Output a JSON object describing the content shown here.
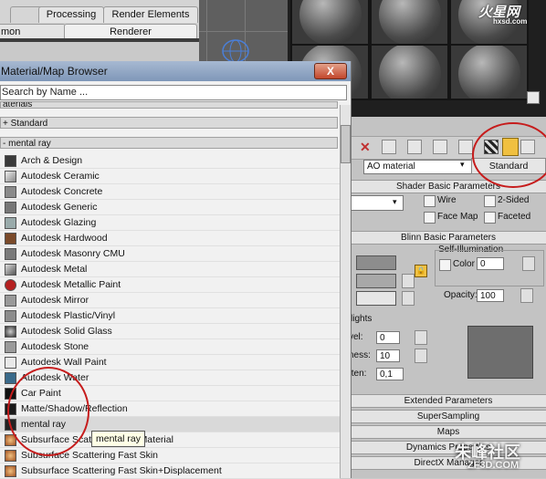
{
  "render_setup": {
    "tabs": [
      "Processing",
      "Render Elements",
      "Renderer"
    ],
    "partial_tab_1": "mon"
  },
  "toolbar": {
    "material_name": "AO material",
    "material_type": "Standard"
  },
  "shader_basic": {
    "title": "Shader Basic Parameters",
    "wire": "Wire",
    "two_sided": "2-Sided",
    "face_map": "Face Map",
    "faceted": "Faceted"
  },
  "blinn_basic": {
    "title": "Blinn Basic Parameters",
    "self_illum": "Self-Illumination",
    "color_label": "Color",
    "color_value": "0",
    "opacity_label": "Opacity:",
    "opacity_value": "100",
    "highlights": "lights",
    "level_label": "vel:",
    "level_value": "0",
    "gloss_label": "ness:",
    "gloss_value": "10",
    "soften_label": "ften:",
    "soften_value": "0,1"
  },
  "rollouts": [
    "Extended Parameters",
    "SuperSampling",
    "Maps",
    "Dynamics Properties",
    "DirectX Manager"
  ],
  "browser": {
    "title": "Material/Map Browser",
    "close": "X",
    "search_placeholder": "Search by Name ...",
    "groups": [
      "aterials",
      "+ Standard",
      "- mental ray"
    ],
    "items": [
      "Arch & Design",
      "Autodesk Ceramic",
      "Autodesk Concrete",
      "Autodesk Generic",
      "Autodesk Glazing",
      "Autodesk Hardwood",
      "Autodesk Masonry CMU",
      "Autodesk Metal",
      "Autodesk Metallic Paint",
      "Autodesk Mirror",
      "Autodesk Plastic/Vinyl",
      "Autodesk Solid Glass",
      "Autodesk Stone",
      "Autodesk Wall Paint",
      "Autodesk Water",
      "Car Paint",
      "Matte/Shadow/Reflection",
      "mental ray",
      "Subsurface Scattering Fast Material",
      "Subsurface Scattering Fast Skin",
      "Subsurface Scattering Fast Skin+Displacement"
    ],
    "tooltip": "mental ray"
  },
  "watermarks": {
    "top_cn": "火星网",
    "top_en": "hxsd.com",
    "bottom_cn": "朱峰社区",
    "bottom_en": "ZF3D.COM"
  },
  "colors": {
    "annotation": "#c61c1c",
    "titlebar": "#8fa5c4"
  }
}
